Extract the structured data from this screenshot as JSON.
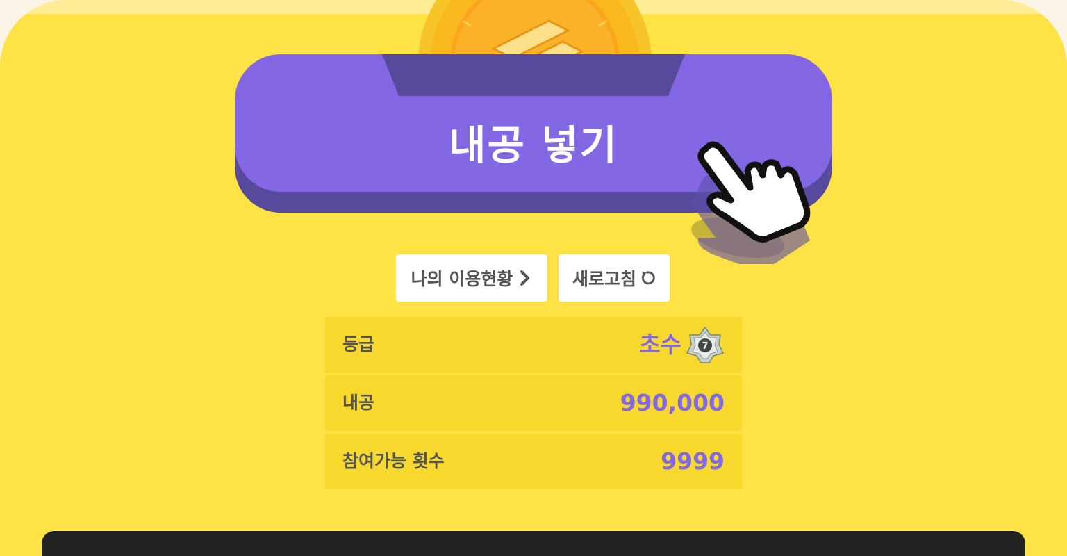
{
  "main_button": {
    "label": "내공 넣기"
  },
  "actions": {
    "usage_label": "나의 이용현황",
    "refresh_label": "새로고침"
  },
  "stats": {
    "grade_label": "등급",
    "grade_value": "초수",
    "grade_badge_number": "7",
    "naegong_label": "내공",
    "naegong_value": "990,000",
    "attempts_label": "참여가능 횟수",
    "attempts_value": "9999"
  },
  "icons": {
    "coin": "coin-icon",
    "hand": "hand-pointer-icon",
    "usage": "chevron-right-icon",
    "refresh": "refresh-icon",
    "badge": "grade-badge-icon"
  },
  "colors": {
    "background": "#ffe246",
    "button": "#8468e3",
    "button_shadow": "#574a9c",
    "row": "#f7d82d",
    "value_text": "#8468e3"
  }
}
